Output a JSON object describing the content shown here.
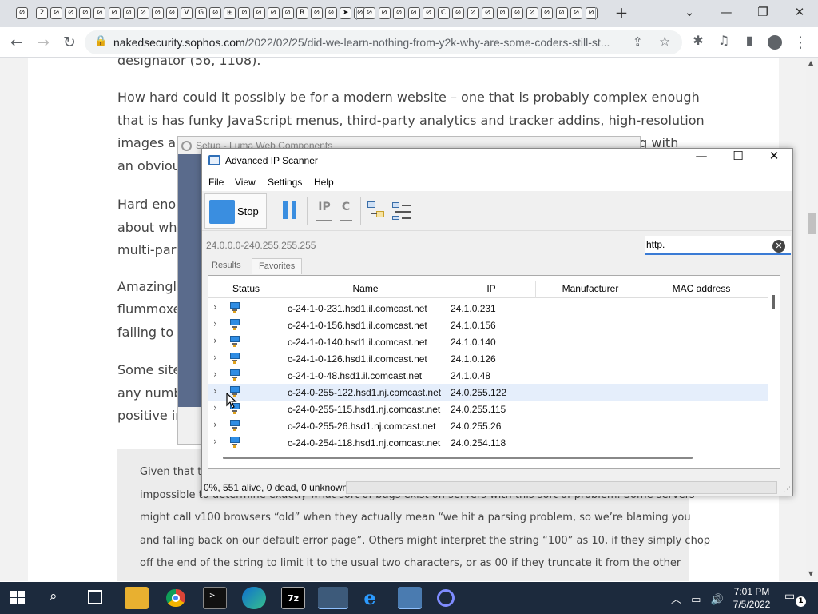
{
  "browser": {
    "tab_favicons": [
      "⊘",
      "2",
      "⊘",
      "⊘",
      "⊘",
      "⊘",
      "⊘",
      "⊘",
      "⊘",
      "⊘",
      "⊘",
      "V",
      "G",
      "⊘",
      "⊞",
      "⊘",
      "⊘",
      "⊘",
      "⊘",
      "R",
      "⊘",
      "⊘",
      "➤",
      "⊘",
      "⊘",
      "⊘",
      "⊘",
      "⊘",
      "⊘",
      "C",
      "⊘",
      "⊘",
      "⊘",
      "⊘",
      "⊘",
      "⊘",
      "⊘",
      "⊘",
      "⊘",
      "⊘"
    ],
    "new_tab_label": "+",
    "url_host": "nakedsecurity.sophos.com",
    "url_path": "/2022/02/25/did-we-learn-nothing-from-y2k-why-are-some-coders-still-st..."
  },
  "article": {
    "top_fragment": "designator (56, 1108).",
    "para1": [
      "How hard could it possibly be for a modern website – one that is probably complex enough",
      "that is has funky JavaScript menus, third-party analytics and tracker addins, high-resolution",
      "images an",
      "an obvious"
    ],
    "para1_tail": "ng with",
    "para2": [
      "Hard enou",
      "about wha",
      "multi-part"
    ],
    "para3": [
      "Amazingly",
      "flummoxe",
      "failing to f"
    ],
    "para4": [
      "Some site",
      "any numb",
      "positive in"
    ],
    "quote_lines": [
      "Given that th",
      "impossible to determine exactly what sort of bugs exist on servers with this sort of problem. Some servers",
      "might call v100 browsers “old” when they actually mean “we hit a parsing problem, so we’re blaming you",
      "and falling back on our default error page”. Others might interpret the string “100” as 10, if they simply chop",
      "off the end of the string to limit it to the usual two characters, or as 00 if they truncate it from the other"
    ]
  },
  "luma_dialog": {
    "title": "Setup - Luma Web Components"
  },
  "scanner": {
    "title": "Advanced IP Scanner",
    "menu": [
      "File",
      "View",
      "Settings",
      "Help"
    ],
    "stop_label": "Stop",
    "tool_ip": "IP",
    "tool_c": "C",
    "range_value": "24.0.0.0-240.255.255.255",
    "search_value": "http.",
    "tabs": [
      "Results",
      "Favorites"
    ],
    "columns": [
      "Status",
      "Name",
      "IP",
      "Manufacturer",
      "MAC address"
    ],
    "rows": [
      {
        "name": "c-24-1-0-231.hsd1.il.comcast.net",
        "ip": "24.1.0.231"
      },
      {
        "name": "c-24-1-0-156.hsd1.il.comcast.net",
        "ip": "24.1.0.156"
      },
      {
        "name": "c-24-1-0-140.hsd1.il.comcast.net",
        "ip": "24.1.0.140"
      },
      {
        "name": "c-24-1-0-126.hsd1.il.comcast.net",
        "ip": "24.1.0.126"
      },
      {
        "name": "c-24-1-0-48.hsd1.il.comcast.net",
        "ip": "24.1.0.48"
      },
      {
        "name": "c-24-0-255-122.hsd1.nj.comcast.net",
        "ip": "24.0.255.122"
      },
      {
        "name": "c-24-0-255-115.hsd1.nj.comcast.net",
        "ip": "24.0.255.115"
      },
      {
        "name": "c-24-0-255-26.hsd1.nj.comcast.net",
        "ip": "24.0.255.26"
      },
      {
        "name": "c-24-0-254-118.hsd1.nj.comcast.net",
        "ip": "24.0.254.118"
      }
    ],
    "selected_row": 5,
    "status_text": "0%, 551 alive, 0 dead, 0 unknown",
    "progress": 0
  },
  "taskbar": {
    "time": "7:01 PM",
    "date": "7/5/2022",
    "seven_zip": "7z",
    "notifications": "1"
  },
  "colors": {
    "accent": "#3a8ee0",
    "taskbar": "#1c2a3d"
  }
}
